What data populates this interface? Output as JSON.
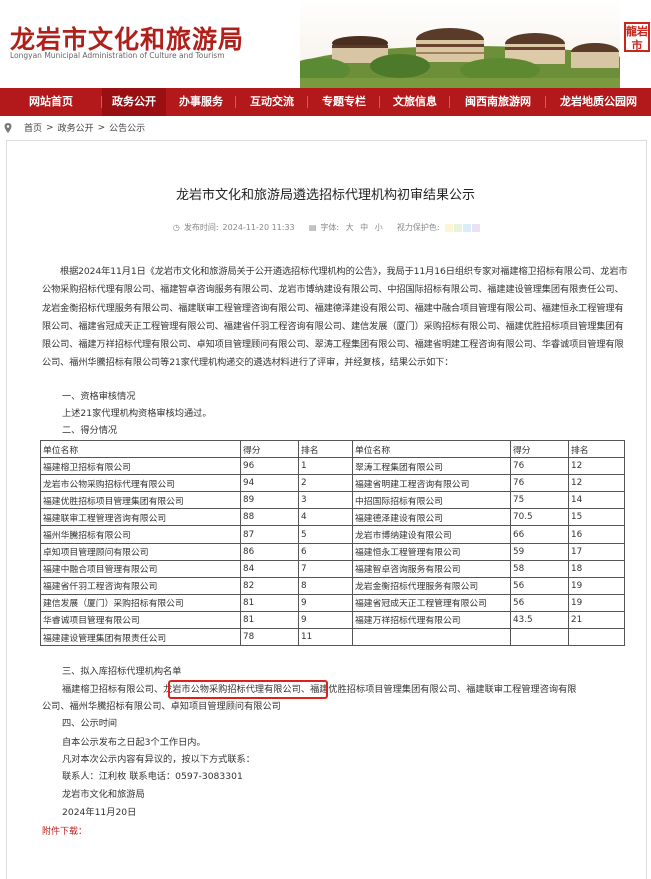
{
  "header": {
    "title": "龙岩市文化和旅游局",
    "subtitle": "Longyan Municipal Administration of Culture and Tourism",
    "seal_text": "龍岩市"
  },
  "nav": {
    "items": [
      {
        "label": "网站首页",
        "active": false
      },
      {
        "label": "政务公开",
        "active": true
      },
      {
        "label": "办事服务",
        "active": false
      },
      {
        "label": "互动交流",
        "active": false
      },
      {
        "label": "专题专栏",
        "active": false
      },
      {
        "label": "文旅信息",
        "active": false
      },
      {
        "label": "闽西南旅游网",
        "active": false
      },
      {
        "label": "龙岩地质公园网",
        "active": false
      }
    ]
  },
  "breadcrumb": [
    "首页",
    ">",
    "政务公开",
    ">",
    "公告公示"
  ],
  "article": {
    "title": "龙岩市文化和旅游局遴选招标代理机构初审结果公示",
    "published_label": "发布时间:",
    "published": "2024-11-20 11:33",
    "font_label": "字体:",
    "font_large": "大",
    "font_medium": "中",
    "font_small": "小",
    "protect_label": "视力保护色:",
    "protect_colors": [
      "#fdf6d6",
      "#e5f5d9",
      "#d9ecf7",
      "#ece1f2"
    ],
    "para1": "根据2024年11月1日《龙岩市文化和旅游局关于公开遴选招标代理机构的公告》，我局于11月16日组织专家对福建榕卫招标有限公司、龙岩市公物采购招标代理有限公司、福建智卓咨询服务有限公司、龙岩市博纳建设有限公司、中招国际招标有限公司、福建建设管理集团有限责任公司、龙岩金衡招标代理服务有限公司、福建联审工程管理咨询有限公司、福建德泽建设有限公司、福建中融合项目管理有限公司、福建恒永工程管理有限公司、福建省冠成天正工程管理有限公司、福建省仟羽工程咨询有限公司、建信发展（厦门）采购招标有限公司、福建优胜招标项目管理集团有限公司、福建万祥招标代理有限公司、卓知项目管理顾问有限公司、翠涛工程集团有限公司、福建省明建工程咨询有限公司、华睿诚项目管理有限公司、福州华騰招标有限公司等21家代理机构递交的遴选材料进行了评审，并经复核，结果公示如下：",
    "sec1": "一、资格审核情况",
    "sec1_text": "上述21家代理机构资格审核均通过。",
    "sec2": "二、得分情况",
    "table_headers": [
      "单位名称",
      "得分",
      "排名",
      "单位名称",
      "得分",
      "排名"
    ],
    "table_rows": [
      [
        "福建榕卫招标有限公司",
        "96",
        "1",
        "翠涛工程集团有限公司",
        "76",
        "12"
      ],
      [
        "龙岩市公物采购招标代理有限公司",
        "94",
        "2",
        "福建省明建工程咨询有限公司",
        "76",
        "12"
      ],
      [
        "福建优胜招标项目管理集团有限公司",
        "89",
        "3",
        "中招国际招标有限公司",
        "75",
        "14"
      ],
      [
        "福建联审工程管理咨询有限公司",
        "88",
        "4",
        "福建德泽建设有限公司",
        "70.5",
        "15"
      ],
      [
        "福州华騰招标有限公司",
        "87",
        "5",
        "龙岩市博纳建设有限公司",
        "66",
        "16"
      ],
      [
        "卓知项目管理顾问有限公司",
        "86",
        "6",
        "福建恒永工程管理有限公司",
        "59",
        "17"
      ],
      [
        "福建中融合项目管理有限公司",
        "84",
        "7",
        "福建智卓咨询服务有限公司",
        "58",
        "18"
      ],
      [
        "福建省仟羽工程咨询有限公司",
        "82",
        "8",
        "龙岩金衡招标代理服务有限公司",
        "56",
        "19"
      ],
      [
        "建信发展（厦门）采购招标有限公司",
        "81",
        "9",
        "福建省冠成天正工程管理有限公司",
        "56",
        "19"
      ],
      [
        "华睿诚项目管理有限公司",
        "81",
        "9",
        "福建万祥招标代理有限公司",
        "43.5",
        "21"
      ],
      [
        "福建建设管理集团有限责任公司",
        "78",
        "11",
        "",
        "",
        ""
      ]
    ],
    "sec3": "三、拟入库招标代理机构名单",
    "sec3_line1a": "福建榕卫招标有限公司、",
    "sec3_line1b": "龙岩市公物采购招标代理有限公司、",
    "sec3_line1c": "福建优胜招标项目管理集团有限公司、福建联审工程管理咨询有限",
    "sec3_line2": "公司、福州华騰招标有限公司、卓知项目管理顾问有限公司",
    "sec4": "四、公示时间",
    "sec4_text": "自本公示发布之日起3个工作日内。",
    "contact_intro": "凡对本次公示内容有异议的，按以下方式联系：",
    "contact": "联系人：江利枚     联系电话：0597-3083301",
    "org": "龙岩市文化和旅游局",
    "date": "2024年11月20日",
    "attachment": "附件下载："
  }
}
